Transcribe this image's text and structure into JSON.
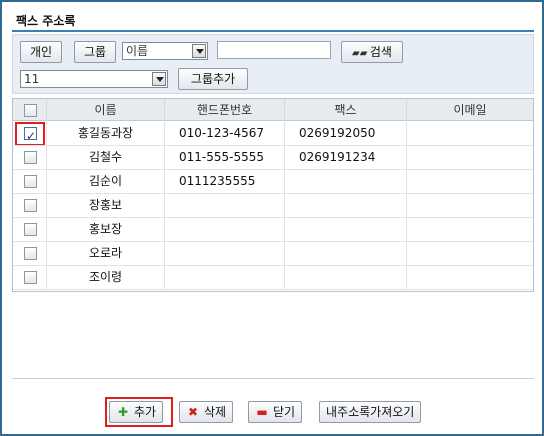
{
  "window": {
    "title": "팩스 주소록"
  },
  "toolbar": {
    "personal_label": "개인",
    "group_label": "그룹",
    "field_select_value": "이름",
    "search_input_value": "",
    "search_label": "검색",
    "group_select_value": "11",
    "add_group_label": "그룹추가"
  },
  "table": {
    "headers": {
      "name": "이름",
      "phone": "핸드폰번호",
      "fax": "팩스",
      "email": "이메일"
    },
    "rows": [
      {
        "checked": true,
        "name": "홍길동과장",
        "phone": "010-123-4567",
        "fax": "0269192050",
        "email": ""
      },
      {
        "checked": false,
        "name": "김철수",
        "phone": "011-555-5555",
        "fax": "0269191234",
        "email": ""
      },
      {
        "checked": false,
        "name": "김순이",
        "phone": "0111235555",
        "fax": "",
        "email": ""
      },
      {
        "checked": false,
        "name": "장홍보",
        "phone": "",
        "fax": "",
        "email": ""
      },
      {
        "checked": false,
        "name": "홍보장",
        "phone": "",
        "fax": "",
        "email": ""
      },
      {
        "checked": false,
        "name": "오로라",
        "phone": "",
        "fax": "",
        "email": ""
      },
      {
        "checked": false,
        "name": "조이령",
        "phone": "",
        "fax": "",
        "email": ""
      }
    ]
  },
  "footer": {
    "add_label": "추가",
    "delete_label": "삭제",
    "close_label": "닫기",
    "import_label": "내주소록가져오기"
  },
  "icons": {
    "search": "binoculars-icon",
    "add": "plus-icon",
    "delete": "x-icon",
    "close": "minus-icon"
  },
  "colors": {
    "accent": "#3e7fb2",
    "highlight": "#e02020",
    "add_icon": "#2e9c2e",
    "delete_icon": "#d02020"
  }
}
